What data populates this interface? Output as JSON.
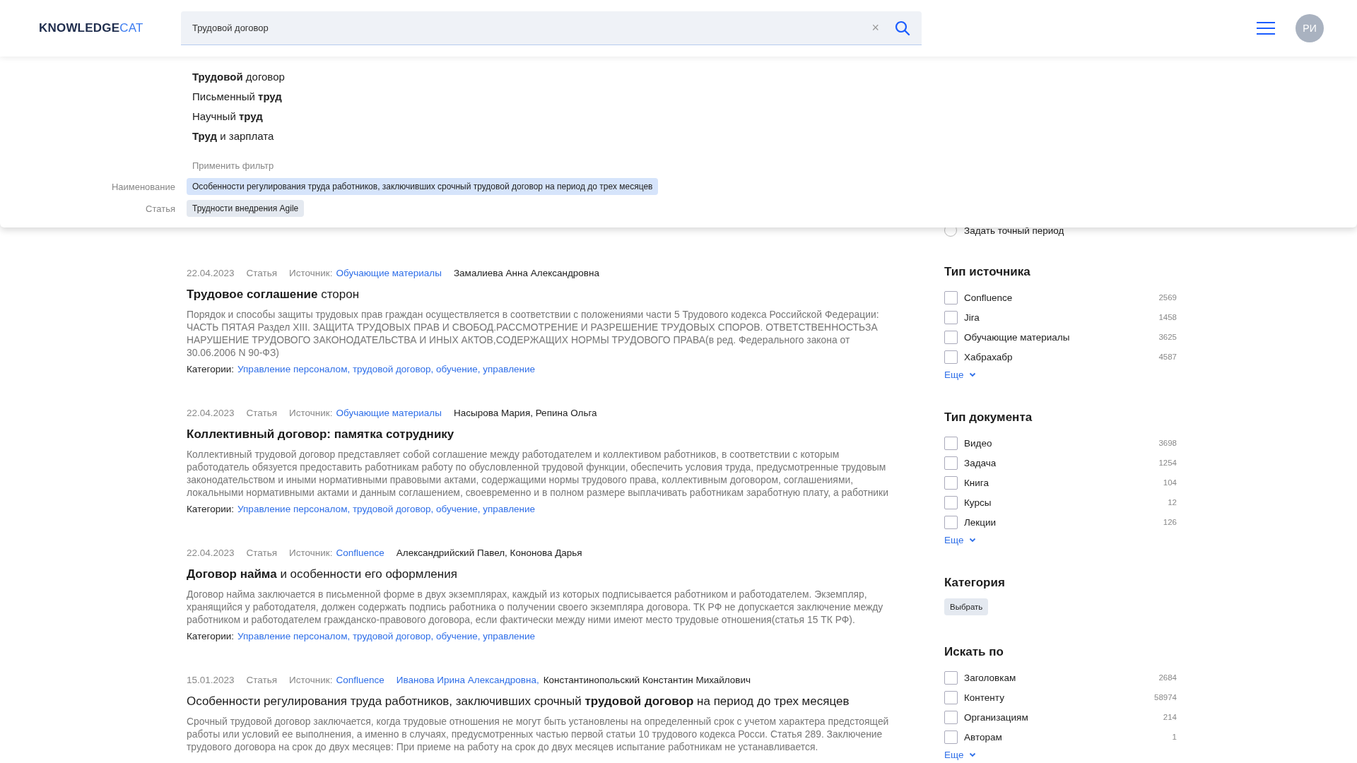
{
  "header": {
    "logo_main": "KNOWLEDGE",
    "logo_accent": "CAT",
    "search": {
      "value": "Трудовой договор",
      "clear": "×"
    },
    "avatar": "РИ"
  },
  "suggestions": [
    "**Трудовой** договор",
    "Письменный **труд**",
    "Научный **труд**",
    "**Труд** и зарплата"
  ],
  "filter_hint": "Применить фильтр",
  "filters": [
    {
      "label": "Наименование",
      "value": "Особенности регулирования труда работников, заключивших срочный трудовой договор на период до трех месяцев",
      "selected": true
    },
    {
      "label": "Статья",
      "value": "Трудности внедрения Agile",
      "selected": false
    }
  ],
  "period_option": {
    "label": "Задать точный период",
    "selected": false
  },
  "results": [
    {
      "date": "22.04.2023",
      "type": "Статья",
      "source_label": "Источник:",
      "source": "Обучающие материалы",
      "authors": [
        {
          "name": "Замалиева Анна Александровна",
          "linked": false
        }
      ],
      "title": "**Трудовое соглашение** сторон",
      "body": "Порядок и способы защиты трудовых прав граждан осуществляется в соответствии с положениями части 5 Трудового кодекса Российской Федерации: ЧАСТЬ ПЯТАЯ Раздел XIII. ЗАЩИТА ТРУДОВЫХ ПРАВ И СВОБОД.РАССМОТРЕНИЕ И РАЗРЕШЕНИЕ ТРУДОВЫХ СПОРОВ. ОТВЕТСТВЕННОСТЬЗА НАРУШЕНИЕ ТРУДОВОГО ЗАКОНОДАТЕЛЬСТВА И ИНЫХ АКТОВ,СОДЕРЖАЩИХ НОРМЫ ТРУДОВОГО ПРАВА(в ред. Федерального закона от 30.06.2006 N 90-ФЗ)",
      "categories_label": "Категории:",
      "categories": "Управление персоналом, трудовой договор, обучение, управление"
    },
    {
      "date": "22.04.2023",
      "type": "Статья",
      "source_label": "Источник:",
      "source": "Обучающие материалы",
      "authors": [
        {
          "name": "Насырова Мария, Репина Ольга",
          "linked": false
        }
      ],
      "title": "**Коллективный договор: памятка сотруднику**",
      "body": "Коллективный трудовой договор представляет собой соглашение между работодателем и коллективом работников, в соответствии с которым работодатель обязуется предоставить работникам работу по обусловленной трудовой функции, обеспечить условия труда, предусмотренные трудовым законодательством и иными нормативными правовыми актами, содержащими нормы трудового права, коллективным договором, соглашениями, локальными нормативными актами и данным соглашением, своевременно и в полном размере выплачивать работникам заработную плату, а работники",
      "categories_label": "Категории:",
      "categories": "Управление персоналом, трудовой договор, обучение, управление"
    },
    {
      "date": "22.04.2023",
      "type": "Статья",
      "source_label": "Источник:",
      "source": "Confluence",
      "authors": [
        {
          "name": "Александрийский Павел, Кононова Дарья",
          "linked": false
        }
      ],
      "title": "**Договор найма** и особенности его оформления",
      "body": "Договор найма заключается в письменной форме в двух экземплярах, каждый из которых подписывается работником и работодателем. Экземпляр, хранящийся у работодателя, должен содержать подпись работника о получении своего экземпляра договора. ТК РФ не допускается заключение между работником и работодателем гражданско-правового договора, если фактически между ними имеют место трудовые отношения(статья 15 ТК РФ).",
      "categories_label": "Категории:",
      "categories": "Управление персоналом, трудовой договор, обучение, управление"
    },
    {
      "date": "15.01.2023",
      "type": "Статья",
      "source_label": "Источник:",
      "source": "Confluence",
      "authors": [
        {
          "name": "Иванова Ирина Александровна,",
          "linked": true
        },
        {
          "name": "Константинопольский Константин Михайлович",
          "linked": false
        }
      ],
      "title": "Особенности регулирования труда работников, заключивших срочный **трудовой договор** на период до трех месяцев",
      "body": "Срочный трудовой договор заключается, когда трудовые отношения не могут быть установлены на определенный срок с учетом характера предстоящей работы или условий ее выполнения, а именно в случаях, предусмотренных частью первой статьи 10 трудового кодекса Росси. Статья 289. Заключение трудового договора на срок до двух месяцев: При приеме на работу на срок до двух месяцев испытание работникам не устанавливается."
    }
  ],
  "sidebar": {
    "sections": [
      {
        "kind": "checklist",
        "title": "Тип источника",
        "items": [
          {
            "label": "Confluence",
            "count": "2569",
            "checked": false
          },
          {
            "label": "Jira",
            "count": "1458",
            "checked": false
          },
          {
            "label": "Обучающие материалы",
            "count": "3625",
            "checked": false
          },
          {
            "label": "Хабрахабр",
            "count": "4587",
            "checked": false
          }
        ],
        "more": "Еще"
      },
      {
        "kind": "checklist",
        "title": "Тип документа",
        "items": [
          {
            "label": "Видео",
            "count": "3698",
            "checked": false
          },
          {
            "label": "Задача",
            "count": "1254",
            "checked": false
          },
          {
            "label": "Книга",
            "count": "104",
            "checked": false
          },
          {
            "label": "Курсы",
            "count": "12",
            "checked": false
          },
          {
            "label": "Лекции",
            "count": "126",
            "checked": false
          }
        ],
        "more": "Еще"
      },
      {
        "kind": "picker",
        "title": "Категория",
        "button": "Выбрать"
      },
      {
        "kind": "checklist",
        "title": "Искать по",
        "items": [
          {
            "label": "Заголовкам",
            "count": "2684",
            "checked": false
          },
          {
            "label": "Контенту",
            "count": "58974",
            "checked": false
          },
          {
            "label": "Организациям",
            "count": "214",
            "checked": false
          },
          {
            "label": "Авторам",
            "count": "1",
            "checked": false
          }
        ],
        "more": "Еще"
      }
    ]
  }
}
